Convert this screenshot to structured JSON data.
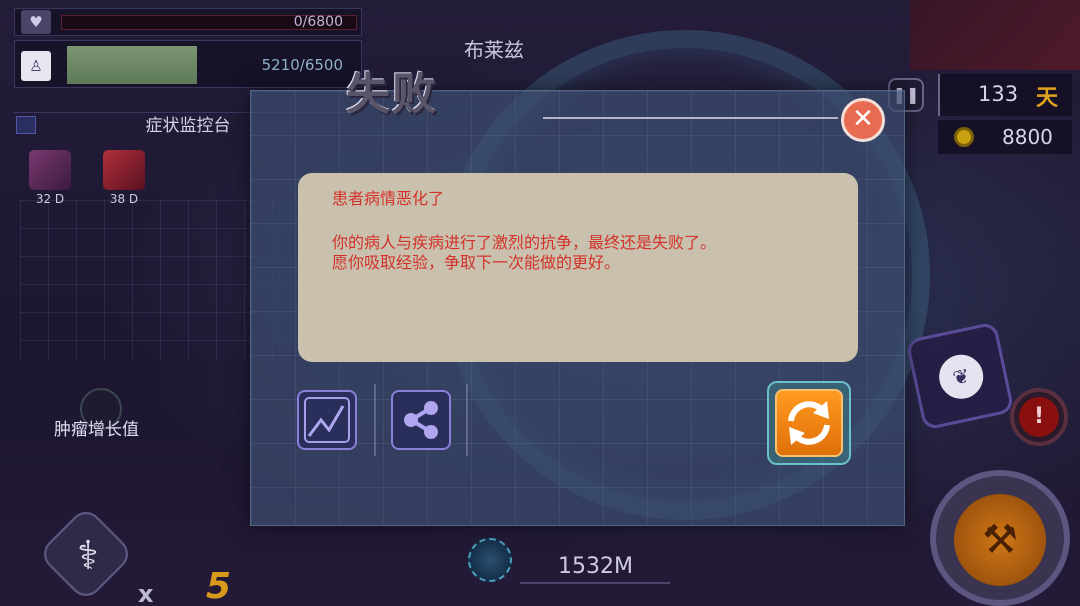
{
  "hud": {
    "health": "0/6800",
    "health_fraction": 0.0,
    "body_strength": "5210/6500",
    "body_fraction": 0.8
  },
  "monitor": {
    "title": "症状监控台",
    "symptoms": [
      {
        "label": "32 D"
      },
      {
        "label": "38 D"
      }
    ],
    "tumor_label": "肿瘤增长值"
  },
  "patient": {
    "name": "布莱兹"
  },
  "status": {
    "days": "133",
    "days_unit": "天",
    "coins": "8800"
  },
  "bottom": {
    "multiplier_x": "x",
    "multiplier_value": "5",
    "population": "1532M"
  },
  "dialog": {
    "title": "失败",
    "heading": "患者病情恶化了",
    "line1": "你的病人与疾病进行了激烈的抗争，最终还是失败了。",
    "line2": "愿你吸取经验，争取下一次能做的更好。"
  },
  "colors": {
    "message_text": "#d2322a",
    "close_button": "#e86a50",
    "retry_button": "#ff9a20",
    "days_unit": "#e0a020"
  },
  "icons": {
    "close": "close-icon",
    "chart": "line-chart-icon",
    "share": "share-icon",
    "retry": "refresh-icon"
  }
}
